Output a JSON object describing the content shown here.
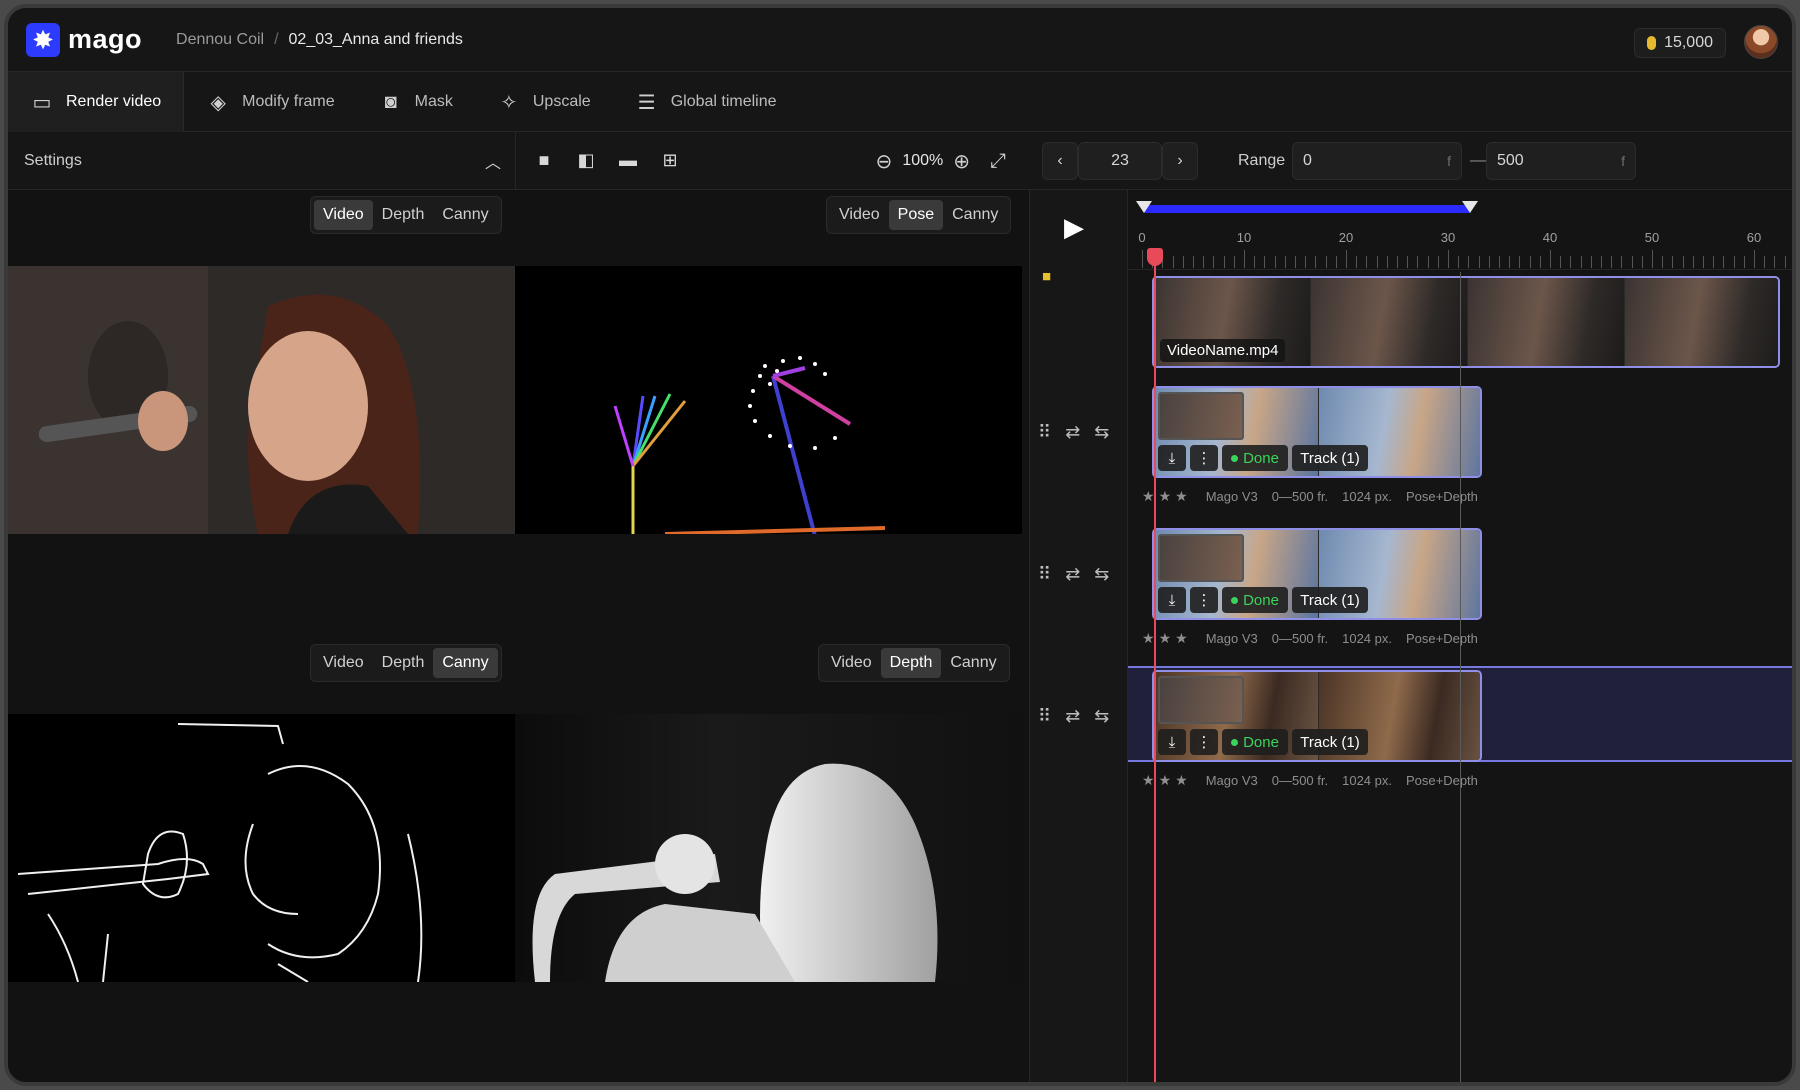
{
  "app": {
    "name": "mago"
  },
  "breadcrumb": {
    "project": "Dennou Coil",
    "scene": "02_03_Anna and friends"
  },
  "credits": "15,000",
  "nav": [
    {
      "label": "Render video",
      "icon": "video-camera-icon"
    },
    {
      "label": "Modify frame",
      "icon": "paint-bucket-icon"
    },
    {
      "label": "Mask",
      "icon": "mask-icon"
    },
    {
      "label": "Upscale",
      "icon": "upscale-icon"
    },
    {
      "label": "Global timeline",
      "icon": "timeline-icon"
    }
  ],
  "settings": {
    "title": "Settings"
  },
  "zoom": "100%",
  "viewer": {
    "tabs_a": [
      "Video",
      "Depth",
      "Canny"
    ],
    "tabs_b": [
      "Video",
      "Pose",
      "Canny"
    ],
    "tabs_c": [
      "Video",
      "Depth",
      "Canny"
    ],
    "tabs_d": [
      "Video",
      "Depth",
      "Canny"
    ],
    "selected": {
      "a": "Video",
      "b": "Pose",
      "c": "Canny",
      "d": "Depth"
    }
  },
  "timeline": {
    "frame": "23",
    "range_label": "Range",
    "range_start": "0",
    "range_end": "500",
    "unit": "f",
    "ticks": [
      "0",
      "10",
      "20",
      "30",
      "40",
      "50",
      "60"
    ],
    "source_clip": "VideoName.mp4",
    "tracks": [
      {
        "status": "Done",
        "track": "Track (1)",
        "model": "Mago V3",
        "frames": "0—500 fr.",
        "res": "1024 px.",
        "modes": "Pose+Depth"
      },
      {
        "status": "Done",
        "track": "Track (1)",
        "model": "Mago V3",
        "frames": "0—500 fr.",
        "res": "1024 px.",
        "modes": "Pose+Depth"
      },
      {
        "status": "Done",
        "track": "Track (1)",
        "model": "Mago V3",
        "frames": "0—500 fr.",
        "res": "1024 px.",
        "modes": "Pose+Depth"
      }
    ]
  },
  "colors": {
    "accent": "#2d3bff",
    "done": "#3ad35b",
    "playhead": "#e84a5a",
    "clip_border": "#8f8fe8"
  }
}
